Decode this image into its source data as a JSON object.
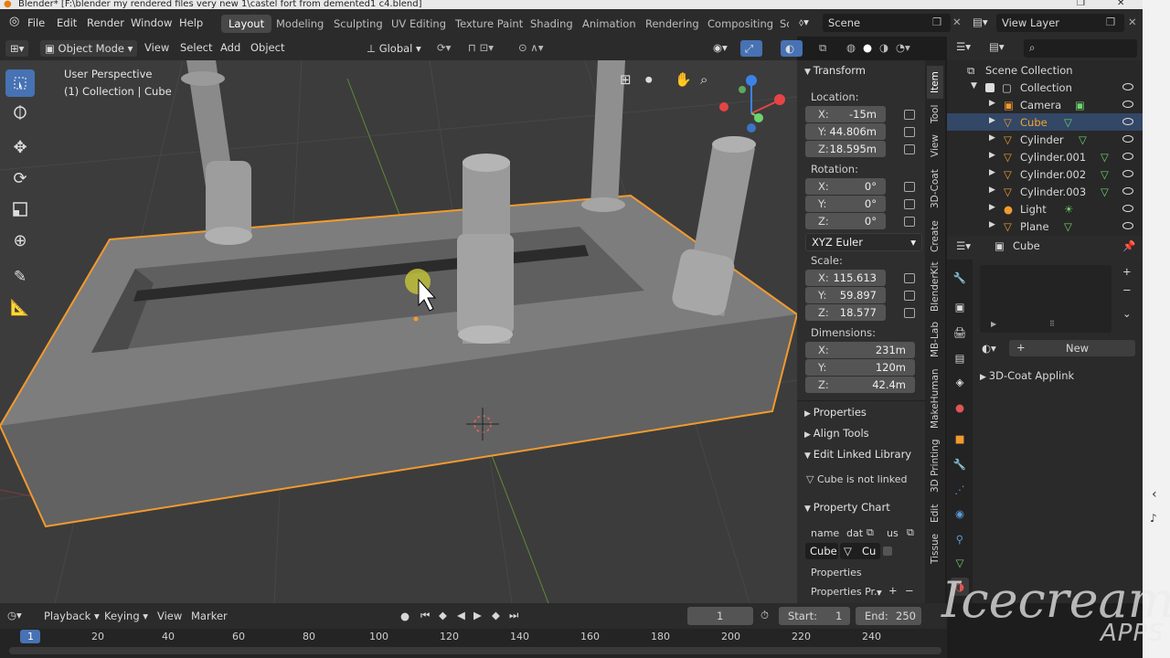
{
  "title_bar": {
    "text": "Blender* [F:\\blender my rendered files very new 1\\castel fort from demented1 c4.blend]"
  },
  "top_menu": [
    "File",
    "Edit",
    "Render",
    "Window",
    "Help"
  ],
  "workspaces": [
    "Layout",
    "Modeling",
    "Sculpting",
    "UV Editing",
    "Texture Paint",
    "Shading",
    "Animation",
    "Rendering",
    "Compositing",
    "Sc"
  ],
  "scene": {
    "label": "Scene",
    "view_layer": "View Layer"
  },
  "viewport_header": {
    "mode": "Object Mode",
    "menus": [
      "View",
      "Select",
      "Add",
      "Object"
    ],
    "orientation": "Global"
  },
  "viewport_info": {
    "line1": "User Perspective",
    "line2": "(1) Collection | Cube"
  },
  "transform": {
    "title": "Transform",
    "location_label": "Location:",
    "location": {
      "x": "-15m",
      "y": "44.806m",
      "z": "18.595m"
    },
    "rotation_label": "Rotation:",
    "rotation": {
      "x": "0°",
      "y": "0°",
      "z": "0°"
    },
    "rotation_mode": "XYZ Euler",
    "scale_label": "Scale:",
    "scale": {
      "x": "115.613",
      "y": "59.897",
      "z": "18.577"
    },
    "dimensions_label": "Dimensions:",
    "dimensions": {
      "x": "231m",
      "y": "120m",
      "z": "42.4m"
    }
  },
  "axis_labels": {
    "x": "X:",
    "y": "Y:",
    "z": "Z:"
  },
  "n_sections": {
    "properties": "Properties",
    "align_tools": "Align Tools",
    "edit_linked": "Edit Linked Library",
    "linked_msg": "Cube is not linked",
    "property_chart": "Property Chart"
  },
  "property_chart": {
    "cols": [
      "name",
      "dat",
      "us"
    ],
    "row_name": "Cube",
    "row_cu": "Cu",
    "props_label": "Properties",
    "props_dropdown": "Properties Pr.."
  },
  "side_tabs": [
    "Item",
    "Tool",
    "View",
    "3D-Coat",
    "Create",
    "BlenderKit",
    "MB-Lab",
    "MakeHuman",
    "3D Printing",
    "Edit",
    "Tissue"
  ],
  "outliner": {
    "root": "Scene Collection",
    "collection": "Collection",
    "items": [
      "Camera",
      "Cube",
      "Cylinder",
      "Cylinder.001",
      "Cylinder.002",
      "Cylinder.003",
      "Light",
      "Plane"
    ]
  },
  "properties_panel": {
    "object": "Cube",
    "new_button": "New",
    "addon": "3D-Coat Applink"
  },
  "timeline": {
    "menus": [
      "Playback",
      "Keying",
      "View",
      "Marker"
    ],
    "current_frame": "1",
    "start_label": "Start:",
    "start": "1",
    "end_label": "End:",
    "end": "250",
    "ticks": [
      "1",
      "20",
      "40",
      "60",
      "80",
      "100",
      "120",
      "140",
      "160",
      "180",
      "200",
      "220",
      "240"
    ]
  },
  "watermark": {
    "line1": "Icecream",
    "line2": "APPS"
  },
  "colors": {
    "accent": "#4772b3",
    "selection": "#f29a2e",
    "active_text": "#f5a623",
    "mesh_green": "#6ed36e"
  }
}
